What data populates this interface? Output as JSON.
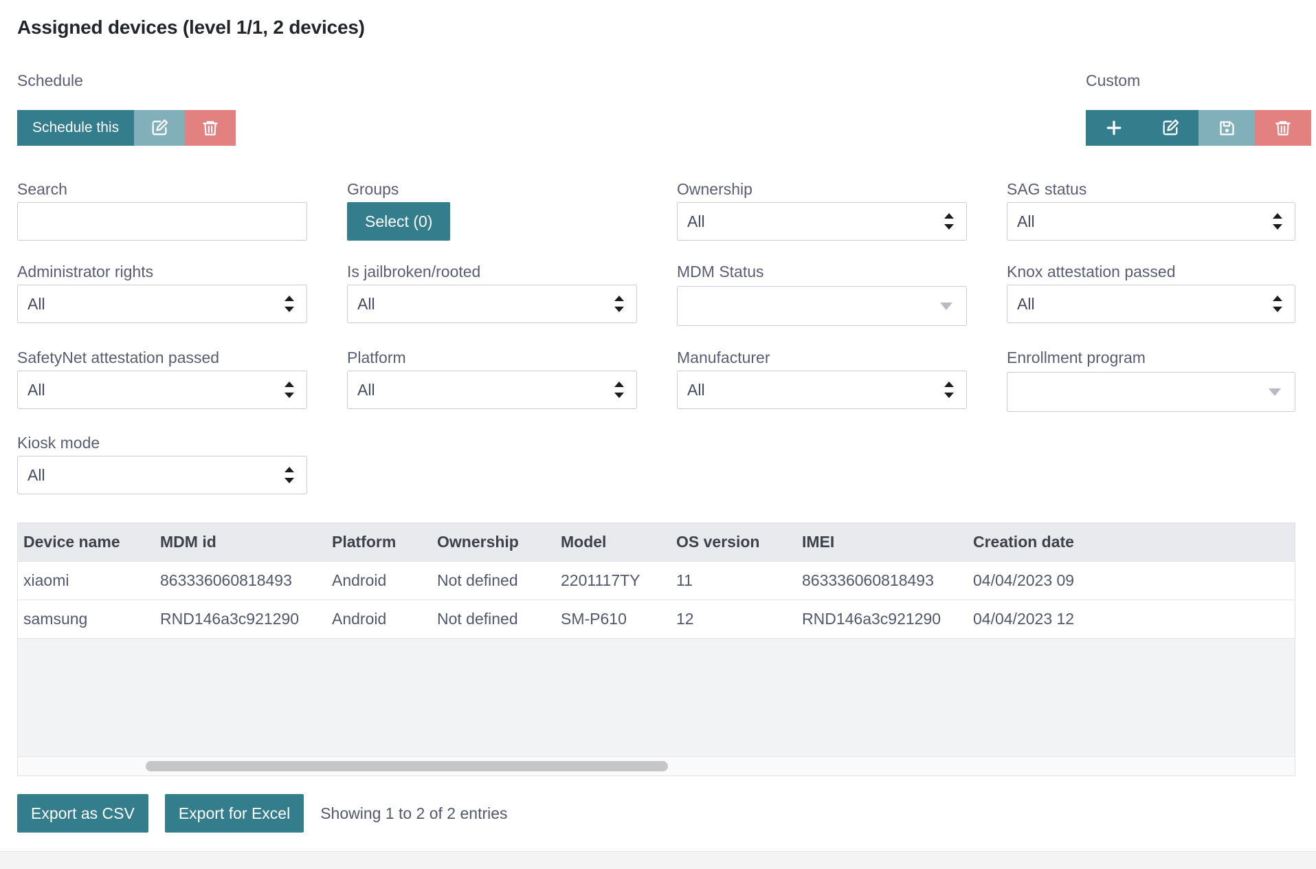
{
  "page": {
    "title": "Assigned devices (level 1/1, 2 devices)"
  },
  "schedule": {
    "label": "Schedule",
    "schedule_this_label": "Schedule this",
    "edit_icon": "edit-square-pencil-icon",
    "delete_icon": "trash-icon"
  },
  "custom": {
    "label": "Custom",
    "add_icon": "plus-icon",
    "edit_icon": "edit-square-pencil-icon",
    "save_icon": "floppy-save-icon",
    "delete_icon": "trash-icon"
  },
  "filters": {
    "search": {
      "label": "Search",
      "value": "",
      "placeholder": ""
    },
    "groups": {
      "label": "Groups",
      "button_label": "Select (0)"
    },
    "ownership": {
      "label": "Ownership",
      "value": "All"
    },
    "sag_status": {
      "label": "SAG status",
      "value": "All"
    },
    "administrator_rights": {
      "label": "Administrator rights",
      "value": "All"
    },
    "is_jailbroken_rooted": {
      "label": "Is jailbroken/rooted",
      "value": "All"
    },
    "mdm_status": {
      "label": "MDM Status",
      "value": ""
    },
    "knox_attestation_passed": {
      "label": "Knox attestation passed",
      "value": "All"
    },
    "safetynet_attestation_passed": {
      "label": "SafetyNet attestation passed",
      "value": "All"
    },
    "platform": {
      "label": "Platform",
      "value": "All"
    },
    "manufacturer": {
      "label": "Manufacturer",
      "value": "All"
    },
    "enrollment_program": {
      "label": "Enrollment program",
      "value": ""
    },
    "kiosk_mode": {
      "label": "Kiosk mode",
      "value": "All"
    }
  },
  "table": {
    "columns": [
      "Device name",
      "MDM id",
      "Platform",
      "Ownership",
      "Model",
      "OS version",
      "IMEI",
      "Creation date"
    ],
    "rows": [
      {
        "device_name": "xiaomi",
        "mdm_id": "863336060818493",
        "platform": "Android",
        "ownership": "Not defined",
        "model": "2201117TY",
        "os_version": "11",
        "imei": "863336060818493",
        "creation_date": "04/04/2023 09"
      },
      {
        "device_name": "samsung",
        "mdm_id": "RND146a3c921290",
        "platform": "Android",
        "ownership": "Not defined",
        "model": "SM-P610",
        "os_version": "12",
        "imei": "RND146a3c921290",
        "creation_date": "04/04/2023 12"
      }
    ]
  },
  "footer": {
    "export_csv_label": "Export as CSV",
    "export_excel_label": "Export for Excel",
    "entries_info": "Showing 1 to 2 of 2 entries"
  },
  "colors": {
    "primary_teal": "#347d8d",
    "light_teal": "#81b0ba",
    "danger_red": "#e38080",
    "label_grey": "#5a5d72",
    "header_bg": "#e9eaee"
  }
}
